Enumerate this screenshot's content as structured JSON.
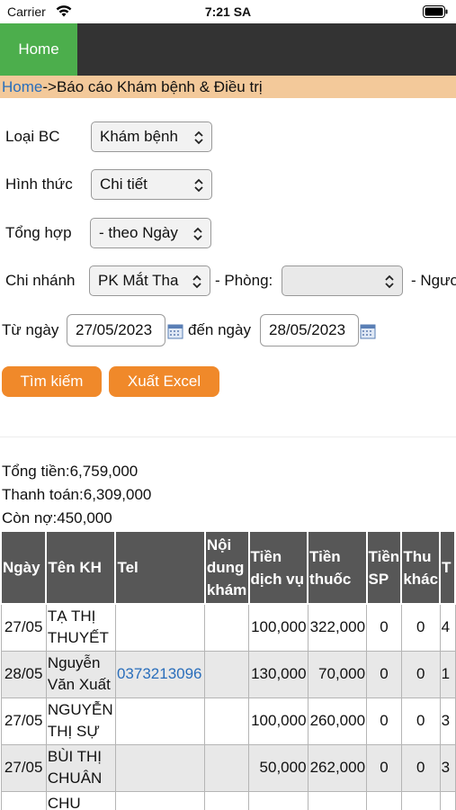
{
  "status_bar": {
    "carrier": "Carrier",
    "time": "7:21 SA"
  },
  "nav": {
    "home": "Home"
  },
  "breadcrumb": {
    "home": "Home",
    "current": "->Báo cáo Khám bệnh & Điều trị"
  },
  "form": {
    "loai_bc": {
      "label": "Loại BC",
      "value": "Khám bệnh"
    },
    "hinh_thuc": {
      "label": "Hình thức",
      "value": "Chi tiết"
    },
    "tong_hop": {
      "label": "Tổng hợp",
      "value": "- theo Ngày"
    },
    "chi_nhanh": {
      "label": "Chi nhánh",
      "value": "PK Mắt Tha"
    },
    "phong": {
      "label": "- Phòng:",
      "value": ""
    },
    "nguoi": {
      "label": "- Ngươ"
    },
    "tu_ngay": {
      "label": "Từ ngày",
      "value": "27/05/2023"
    },
    "den_ngay": {
      "label": "đến ngày",
      "value": "28/05/2023"
    },
    "search_button": "Tìm kiếm",
    "export_button": "Xuất Excel"
  },
  "summary": {
    "total": "Tổng tiền:6,759,000",
    "paid": "Thanh toán:6,309,000",
    "debt": "Còn nợ:450,000"
  },
  "table": {
    "headers": [
      "Ngày",
      "Tên KH",
      "Tel",
      "Nội dung khám",
      "Tiền dịch vụ",
      "Tiền thuốc",
      "Tiền SP",
      "Thu khác",
      "T"
    ],
    "rows": [
      [
        "27/05",
        "TẠ THỊ THUYẾT",
        "",
        "",
        "100,000",
        "322,000",
        "0",
        "0",
        "4"
      ],
      [
        "28/05",
        "Nguyễn Văn Xuất",
        "0373213096",
        "",
        "130,000",
        "70,000",
        "0",
        "0",
        "1"
      ],
      [
        "27/05",
        "NGUYỄN THỊ SỰ",
        "",
        "",
        "100,000",
        "260,000",
        "0",
        "0",
        "3"
      ],
      [
        "27/05",
        "BÙI THỊ CHUÂN",
        "",
        "",
        "50,000",
        "262,000",
        "0",
        "0",
        "3"
      ],
      [
        "",
        "CHU",
        "",
        "",
        "",
        "",
        "",
        "",
        ""
      ]
    ]
  }
}
